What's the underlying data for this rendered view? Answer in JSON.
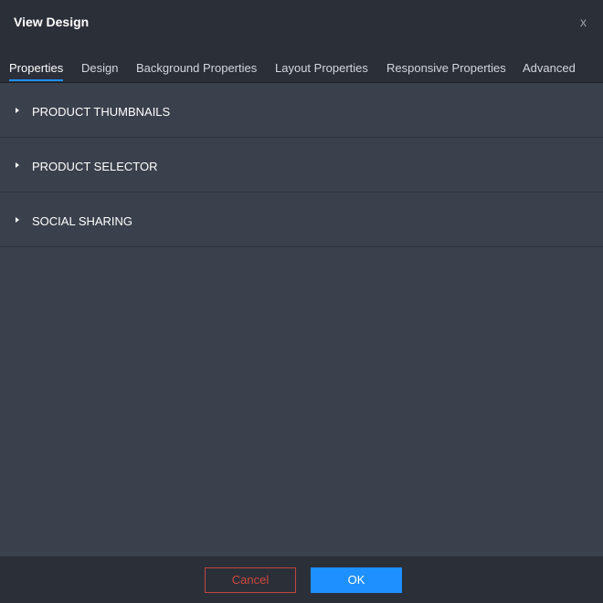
{
  "dialog": {
    "title": "View Design",
    "close_label": "x"
  },
  "tabs": [
    {
      "label": "Properties",
      "active": true
    },
    {
      "label": "Design",
      "active": false
    },
    {
      "label": "Background Properties",
      "active": false
    },
    {
      "label": "Layout Properties",
      "active": false
    },
    {
      "label": "Responsive Properties",
      "active": false
    },
    {
      "label": "Advanced",
      "active": false
    }
  ],
  "sections": [
    {
      "label": "PRODUCT THUMBNAILS",
      "expanded": false
    },
    {
      "label": "PRODUCT SELECTOR",
      "expanded": false
    },
    {
      "label": "SOCIAL SHARING",
      "expanded": false
    }
  ],
  "footer": {
    "cancel_label": "Cancel",
    "ok_label": "OK"
  },
  "colors": {
    "accent": "#1e90ff",
    "cancel": "#d0483c",
    "background": "#3a404c",
    "header": "#2b2f38"
  },
  "icons": {
    "close": "close-icon",
    "section_caret": "caret-right-icon"
  }
}
